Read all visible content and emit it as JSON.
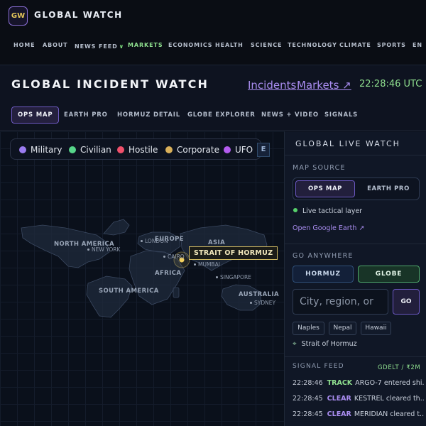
{
  "app": {
    "logo": "GW",
    "brand": "GLOBAL WATCH"
  },
  "nav": {
    "items": [
      "HOME",
      "ABOUT",
      "NEWS FEED",
      "MARKETS",
      "ECONOMICS",
      "HEALTH",
      "SCIENCE",
      "TECHNOLOGY",
      "CLIMATE",
      "SPORTS",
      "EN"
    ],
    "active": "MARKETS"
  },
  "header": {
    "title": "GLOBAL INCIDENT WATCH",
    "link_incidents": "Incidents",
    "link_markets": "Markets ↗",
    "clock": "22:28:46 UTC"
  },
  "tabs": [
    "OPS MAP",
    "EARTH PRO",
    "HORMUZ DETAIL",
    "GLOBE EXPLORER",
    "NEWS + VIDEO",
    "SIGNALS"
  ],
  "legend": {
    "items": [
      {
        "label": "Military",
        "color": "#9b7cf0"
      },
      {
        "label": "Civilian",
        "color": "#57d68a"
      },
      {
        "label": "Hostile",
        "color": "#f0506b"
      },
      {
        "label": "Corporate",
        "color": "#d9b05a"
      },
      {
        "label": "UFO",
        "color": "#b45cf0"
      }
    ],
    "edge_letter": "E"
  },
  "map": {
    "regions": [
      "NORTH AMERICA",
      "EUROPE",
      "ASIA",
      "AFRICA",
      "SOUTH AMERICA",
      "AUSTRALIA"
    ],
    "cities": [
      "NEW YORK",
      "LONDON",
      "CAIRO",
      "MUMBAI",
      "SINGAPORE",
      "SYDNEY"
    ],
    "highlight": "STRAIT OF HORMUZ"
  },
  "sidebar": {
    "title": "GLOBAL LIVE WATCH",
    "map_source": {
      "heading": "MAP SOURCE",
      "options": [
        "OPS MAP",
        "EARTH PRO"
      ],
      "active": "OPS MAP",
      "status": "Live tactical layer",
      "link": "Open Google Earth ↗"
    },
    "go_anywhere": {
      "heading": "GO ANYWHERE",
      "buttons": [
        "HORMUZ",
        "GLOBE"
      ],
      "search_placeholder": "City, region, or",
      "go_label": "GO",
      "chips": [
        "Naples",
        "Nepal",
        "Hawaii"
      ],
      "current": "Strait of Hormuz"
    },
    "feed": {
      "heading": "SIGNAL FEED",
      "source": "GDELT / ₹2M",
      "rows": [
        {
          "time": "22:28:46",
          "kind": "TRACK",
          "msg": "ARGO-7 entered shi..."
        },
        {
          "time": "22:28:45",
          "kind": "CLEAR",
          "msg": "KESTREL cleared th..."
        },
        {
          "time": "22:28:45",
          "kind": "CLEAR",
          "msg": "MERIDIAN cleared t..."
        }
      ]
    }
  }
}
